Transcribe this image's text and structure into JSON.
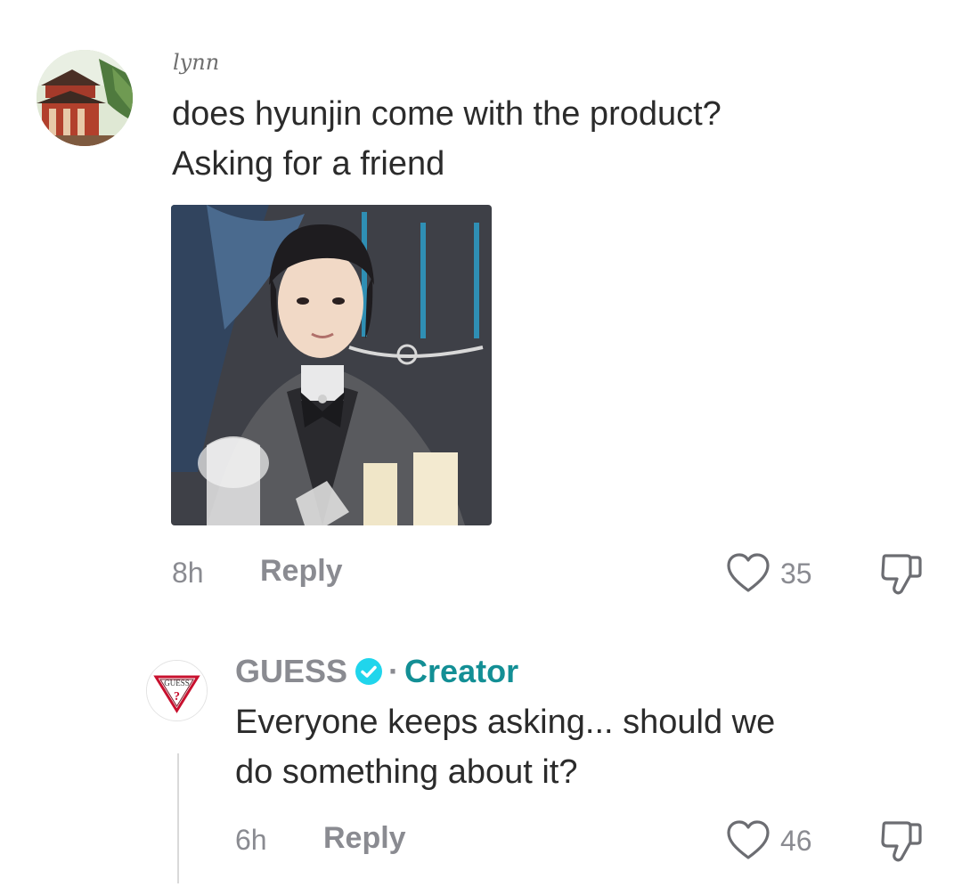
{
  "comments": [
    {
      "username": "lynn",
      "text_line1": "does hyunjin come with the product?",
      "text_line2": "Asking for a friend",
      "time": "8h",
      "reply_label": "Reply",
      "likes": "35"
    }
  ],
  "reply": {
    "username": "GUESS",
    "verified": true,
    "separator": "·",
    "badge": "Creator",
    "avatar_logo_text": "GUESS",
    "text_line1": "Everyone keeps asking... should we",
    "text_line2": "do something about it?",
    "time": "6h",
    "reply_label": "Reply",
    "likes": "46"
  },
  "icons": {
    "like": "heart-outline-icon",
    "dislike": "thumbs-down-outline-icon",
    "verified": "verified-check-icon"
  },
  "colors": {
    "creator_accent": "#138f95",
    "verified_badge": "#20d5ec",
    "muted_text": "#8a8b91"
  }
}
